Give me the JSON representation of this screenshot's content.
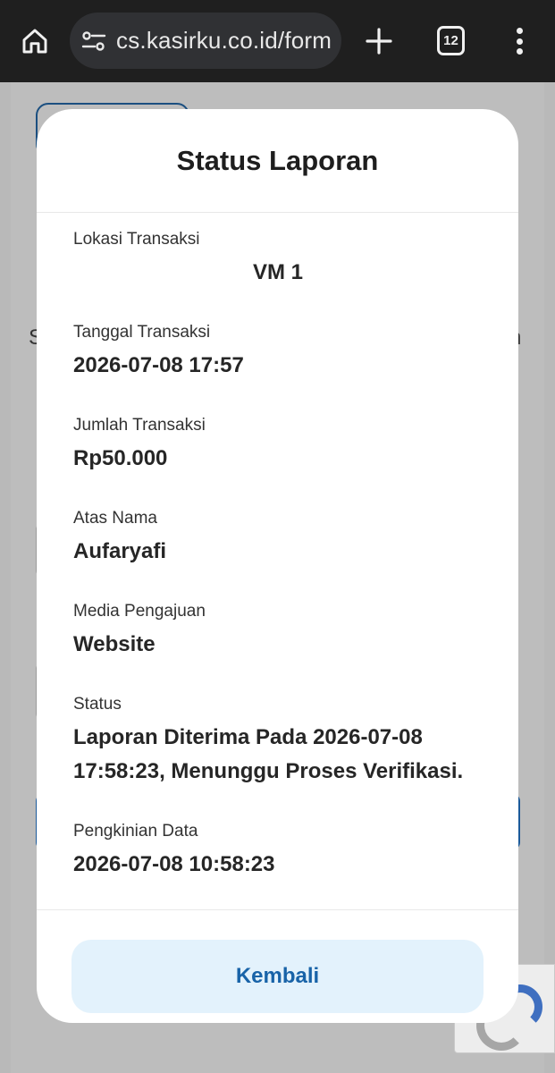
{
  "browser": {
    "url": "cs.kasirku.co.id/form",
    "tab_count": "12"
  },
  "background": {
    "left_letter": "S",
    "right_letter": "n"
  },
  "modal": {
    "title": "Status Laporan",
    "fields": [
      {
        "label": "Lokasi Transaksi",
        "value": "VM 1"
      },
      {
        "label": "Tanggal Transaksi",
        "value": "2026-07-08 17:57"
      },
      {
        "label": "Jumlah Transaksi",
        "value": "Rp50.000"
      },
      {
        "label": "Atas Nama",
        "value": "Aufaryafi"
      },
      {
        "label": "Media Pengajuan",
        "value": "Website"
      },
      {
        "label": "Status",
        "value": "Laporan Diterima Pada 2026-07-08 17:58:23, Menunggu Proses Verifikasi."
      },
      {
        "label": "Pengkinian Data",
        "value": "2026-07-08 10:58:23"
      }
    ],
    "back_label": "Kembali"
  },
  "colors": {
    "browser_bar": "#1f1f1f",
    "accent": "#1863a8",
    "button_bg": "#e3f2fc"
  }
}
